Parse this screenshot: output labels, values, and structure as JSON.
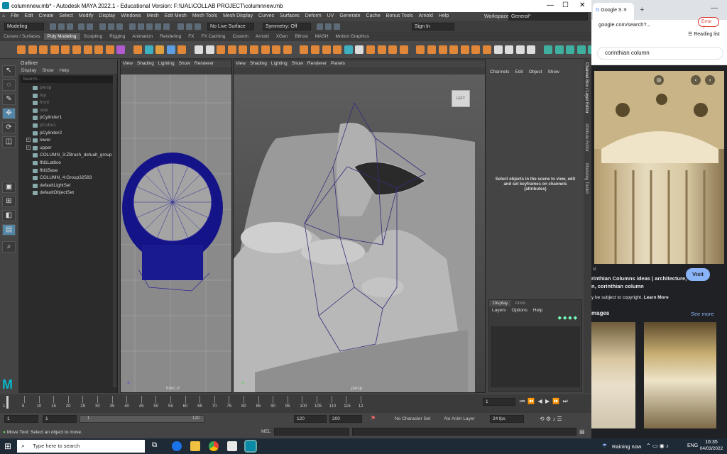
{
  "titlebar": {
    "title": "columnnew.mb* - Autodesk MAYA 2022.1 - Educational Version: F:\\UAL\\COLLAB PROJECT\\columnnew.mb",
    "minimize": "—",
    "maximize": "☐",
    "close": "✕"
  },
  "menubar": [
    "File",
    "Edit",
    "Create",
    "Select",
    "Modify",
    "Display",
    "Windows",
    "Mesh",
    "Edit Mesh",
    "Mesh Tools",
    "Mesh Display",
    "Curves",
    "Surfaces",
    "Deform",
    "UV",
    "Generate",
    "Cache",
    "Bonus Tools",
    "Arnold",
    "Help"
  ],
  "workspace": {
    "label": "Workspace :",
    "value": "General*"
  },
  "statusline": {
    "mode": "Modeling",
    "live_surface": "No Live Surface",
    "symmetry": "Symmetry: Off",
    "sign_in": "Sign In"
  },
  "shelf_tabs": [
    "Curves / Surfaces",
    "Poly Modeling",
    "Sculpting",
    "Rigging",
    "Animation",
    "Rendering",
    "FX",
    "FX Caching",
    "Custom",
    "Arnold",
    "XGen",
    "Bifrost",
    "MASH",
    "Motion Graphics"
  ],
  "shelf_active": "Poly Modeling",
  "outliner": {
    "title": "Outliner",
    "menu": [
      "Display",
      "Show",
      "Help"
    ],
    "search_placeholder": "Search...",
    "items": [
      {
        "label": "persp",
        "dim": true,
        "expand": false
      },
      {
        "label": "top",
        "dim": true,
        "expand": false
      },
      {
        "label": "front",
        "dim": true,
        "expand": false
      },
      {
        "label": "side",
        "dim": true,
        "expand": false
      },
      {
        "label": "pCylinder1",
        "dim": false,
        "expand": false
      },
      {
        "label": "pCube1",
        "dim": true,
        "expand": false
      },
      {
        "label": "pCylinder2",
        "dim": false,
        "expand": false
      },
      {
        "label": "lower",
        "dim": false,
        "expand": true
      },
      {
        "label": "upper",
        "dim": false,
        "expand": true
      },
      {
        "label": "COLUMN_3:ZBrush_defualt_group",
        "dim": false,
        "expand": false
      },
      {
        "label": "ffd1Lattice",
        "dim": false,
        "expand": false
      },
      {
        "label": "ffd1Base",
        "dim": false,
        "expand": false
      },
      {
        "label": "COLUMN_4:Group32583",
        "dim": false,
        "expand": false
      },
      {
        "label": "defaultLightSet",
        "dim": false,
        "expand": false
      },
      {
        "label": "defaultObjectSet",
        "dim": false,
        "expand": false
      }
    ]
  },
  "viewport_front": {
    "menu": [
      "View",
      "Shading",
      "Lighting",
      "Show",
      "Renderer"
    ],
    "label": "front -Y"
  },
  "viewport_persp": {
    "menu": [
      "View",
      "Shading",
      "Lighting",
      "Show",
      "Renderer",
      "Panels"
    ],
    "label": "persp",
    "viewcube": "LEFT"
  },
  "channel_box": {
    "menu": [
      "Channels",
      "Edit",
      "Object",
      "Show"
    ],
    "message": "Select objects in the scene to view, edit and set keyframes on channels (attributes)",
    "side_tabs": [
      "Channel Box / Layer Editor",
      "Attribute Editor",
      "Modeling Toolkit"
    ],
    "layers": {
      "tabs": [
        "Display",
        "Anim"
      ],
      "active": "Display",
      "menu": [
        "Layers",
        "Options",
        "Help"
      ]
    }
  },
  "timeline": {
    "ticks": [
      "5",
      "10",
      "15",
      "20",
      "25",
      "30",
      "35",
      "40",
      "45",
      "50",
      "55",
      "60",
      "65",
      "70",
      "75",
      "80",
      "85",
      "90",
      "95",
      "100",
      "105",
      "110",
      "115",
      "12"
    ],
    "start_tick": "1",
    "current_frame": "1"
  },
  "range": {
    "start": "1",
    "start2": "1",
    "slider_start": "1",
    "slider_end": "120",
    "end": "120",
    "end2": "200",
    "character_set": "No Character Set",
    "anim_layer": "No Anim Layer",
    "fps": "24 fps"
  },
  "cmdline": {
    "lang": "MEL",
    "help": "Move Tool: Select an object to move."
  },
  "browser": {
    "tab_label": "Google S",
    "new_tab": "+",
    "minimize": "—",
    "url": "google.com/search?...",
    "error": "Error",
    "reading_list": "Reading list",
    "search_query": "corinthian column",
    "visit": "Visit",
    "result_title_1": "rinthian Columns ideas | architecture,",
    "result_title_2": "n, corinthian column",
    "result_source": "st",
    "copyright": "y be subject to copyright.",
    "learn_more": "Learn More",
    "images_heading": "mages",
    "see_more": "See more"
  },
  "taskbar": {
    "search_placeholder": "Type here to search",
    "weather": "Raining now",
    "lang": "ENG",
    "time": "16:35",
    "date": "04/03/2022"
  },
  "colors": {
    "maya_bg": "#444444",
    "selected_tool": "#5285a6",
    "lattice": "#2a2496",
    "browser_dark": "#202124",
    "visit_button": "#8ab4f8",
    "link": "#8ab4f8"
  }
}
